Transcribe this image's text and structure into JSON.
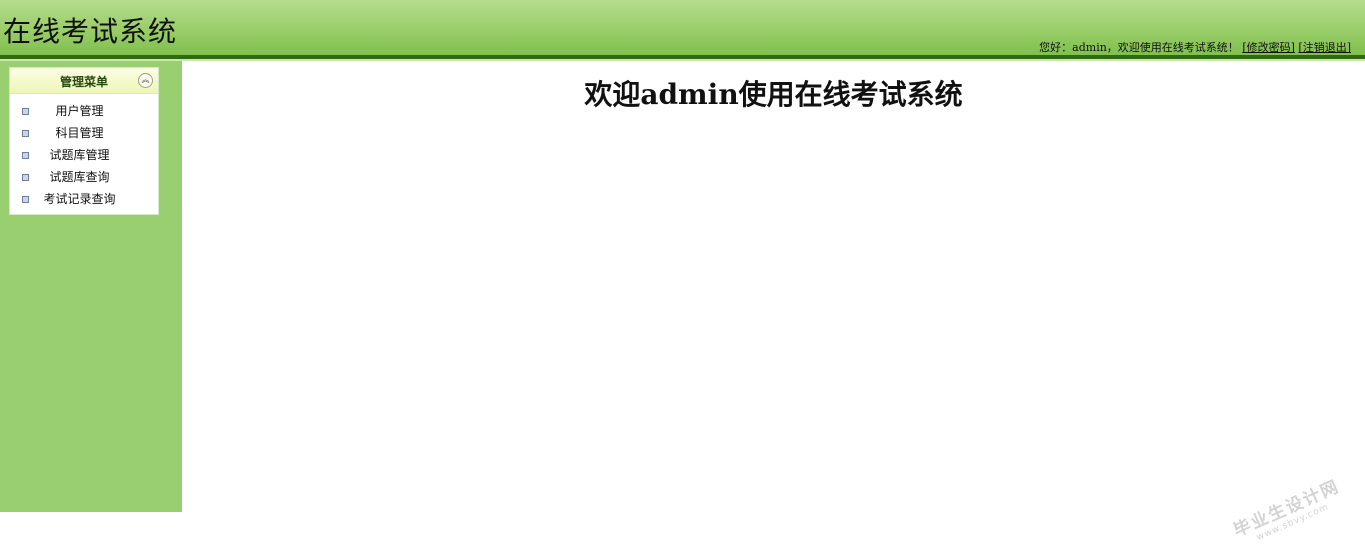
{
  "header": {
    "title": "在线考试系统",
    "greeting": "您好：admin，欢迎使用在线考试系统！",
    "change_password": "[修改密码]",
    "logout": "[注销退出]"
  },
  "sidebar": {
    "menu_title": "管理菜单",
    "collapse_icon": "double-chevron-up-icon",
    "items": [
      {
        "label": "用户管理"
      },
      {
        "label": "科目管理"
      },
      {
        "label": "试题库管理"
      },
      {
        "label": "试题库查询"
      },
      {
        "label": "考试记录查询"
      }
    ]
  },
  "main": {
    "welcome": "欢迎admin使用在线考试系统"
  },
  "watermark": {
    "line1": "毕业生设计网",
    "line2": "www.sbvy.com"
  },
  "colors": {
    "header_green": "#9fd06f",
    "header_border": "#2f6a12",
    "sidebar_green": "#99cf71"
  }
}
